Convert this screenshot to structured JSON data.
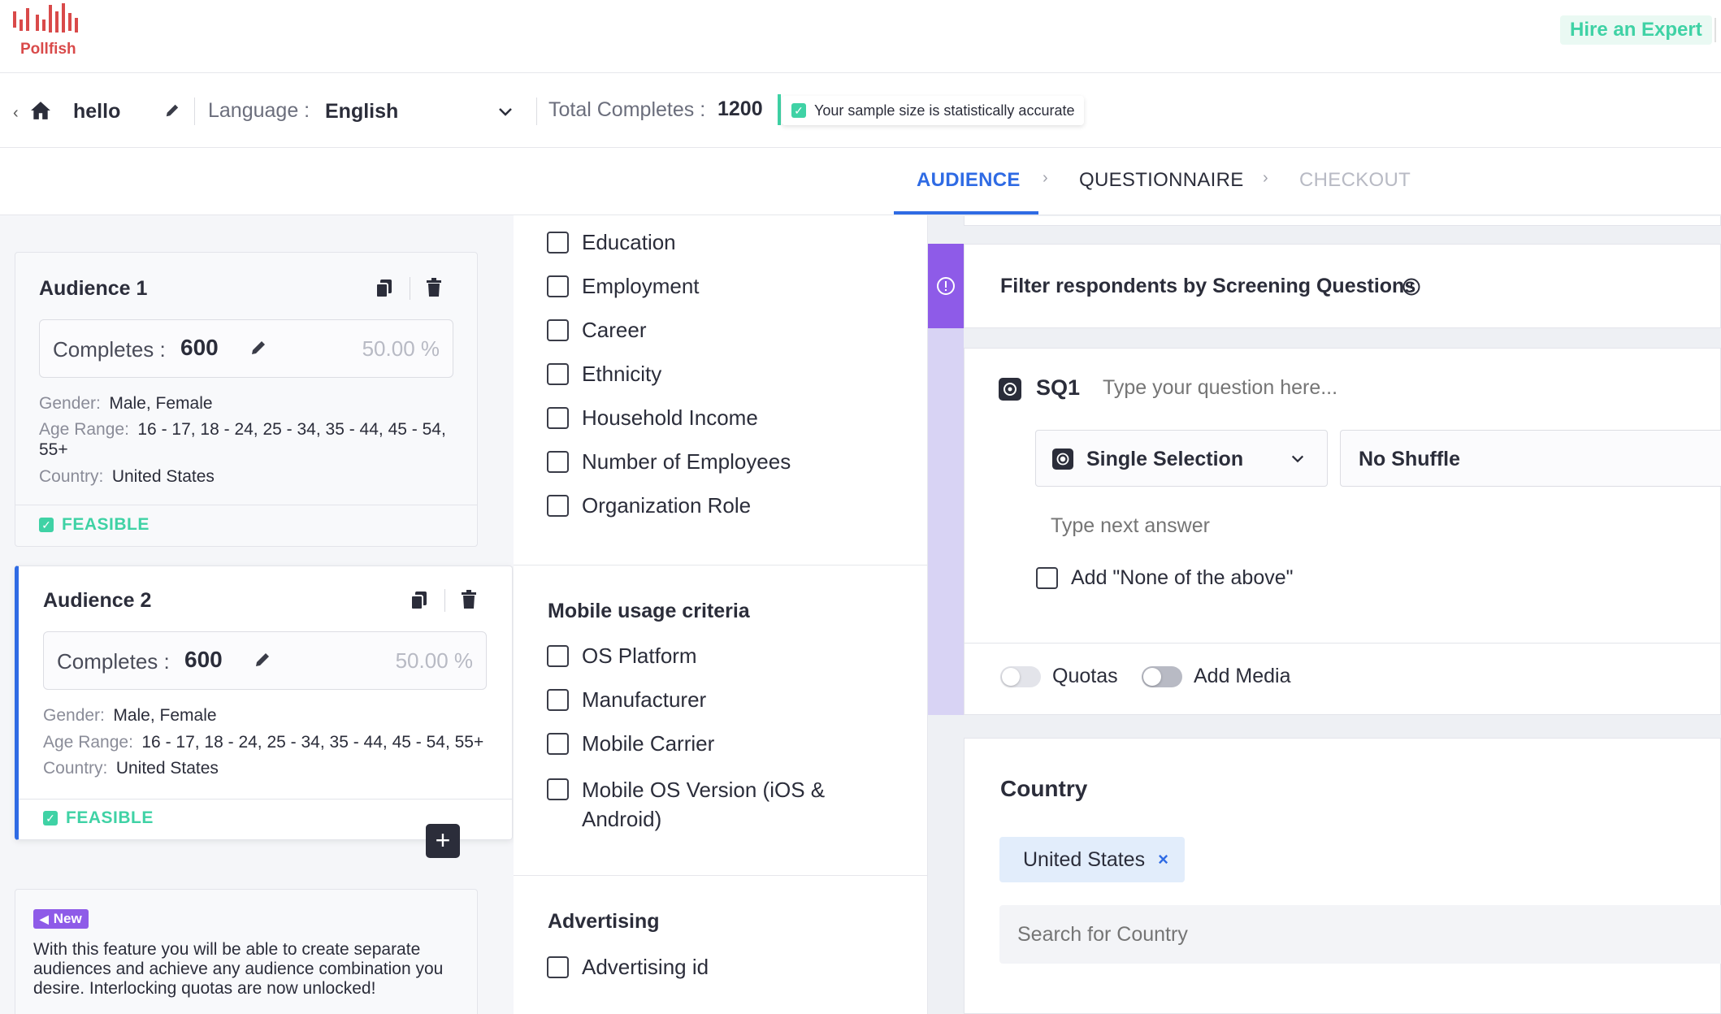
{
  "brand": {
    "name": "Pollfish",
    "color": "#d94a4a",
    "hire_label": "Hire an Expert",
    "accent_green": "#3fd2a5"
  },
  "infobar": {
    "survey_name": "hello",
    "language_label": "Language :",
    "language_value": "English",
    "total_label": "Total Completes :",
    "total_value": "1200",
    "sample_msg": "Your sample size is statistically accurate"
  },
  "steps": [
    {
      "label": "AUDIENCE",
      "state": "active"
    },
    {
      "label": "QUESTIONNAIRE",
      "state": "normal"
    },
    {
      "label": "CHECKOUT",
      "state": "disabled"
    }
  ],
  "audiences": [
    {
      "title": "Audience 1",
      "completes_label": "Completes :",
      "completes_value": "600",
      "percent": "50.00 %",
      "gender_label": "Gender:",
      "gender_value": "Male, Female",
      "age_label": "Age Range:",
      "age_value": "16 - 17, 18 - 24, 25 - 34, 35 - 44, 45 - 54, 55+",
      "country_label": "Country:",
      "country_value": "United States",
      "status": "FEASIBLE"
    },
    {
      "title": "Audience 2",
      "completes_label": "Completes :",
      "completes_value": "600",
      "percent": "50.00 %",
      "gender_label": "Gender:",
      "gender_value": "Male, Female",
      "age_label": "Age Range:",
      "age_value": "16 - 17, 18 - 24, 25 - 34, 35 - 44, 45 - 54, 55+",
      "country_label": "Country:",
      "country_value": "United States",
      "status": "FEASIBLE"
    }
  ],
  "new_feature": {
    "badge": "New",
    "text": "With this feature you will be able to create separate audiences and achieve any audience combination you desire. Interlocking quotas are now unlocked!"
  },
  "criteria": {
    "demographics": [
      "Education",
      "Employment",
      "Career",
      "Ethnicity",
      "Household Income",
      "Number of Employees",
      "Organization Role"
    ],
    "mobile_title": "Mobile usage criteria",
    "mobile": [
      "OS Platform",
      "Manufacturer",
      "Mobile Carrier",
      "Mobile OS Version (iOS & Android)"
    ],
    "advertising_title": "Advertising",
    "advertising": [
      "Advertising id"
    ]
  },
  "screening": {
    "title": "Filter respondents by Screening Questions",
    "sq_label": "SQ1",
    "question_placeholder": "Type your question here...",
    "type_value": "Single Selection",
    "shuffle_value": "No Shuffle",
    "answer_placeholder": "Type next answer",
    "none_above_label": "Add \"None of the above\"",
    "quotas_label": "Quotas",
    "media_label": "Add Media"
  },
  "country": {
    "title": "Country",
    "selected": "United States",
    "search_placeholder": "Search for Country"
  }
}
